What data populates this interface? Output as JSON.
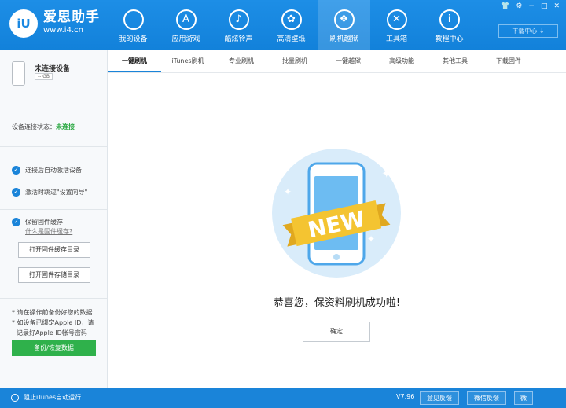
{
  "header": {
    "brand_name": "爱思助手",
    "brand_url": "www.i4.cn",
    "logo_text": "iU",
    "nav": [
      {
        "label": "我的设备",
        "icon": "apple-icon",
        "glyph": ""
      },
      {
        "label": "应用游戏",
        "icon": "app-store-icon",
        "glyph": "A"
      },
      {
        "label": "酷炫铃声",
        "icon": "bell-icon",
        "glyph": "♪"
      },
      {
        "label": "高清壁纸",
        "icon": "flower-icon",
        "glyph": "✿"
      },
      {
        "label": "刷机越狱",
        "icon": "dropbox-icon",
        "glyph": "❖"
      },
      {
        "label": "工具箱",
        "icon": "tools-icon",
        "glyph": "✕"
      },
      {
        "label": "教程中心",
        "icon": "info-icon",
        "glyph": "i"
      }
    ],
    "download_center": "下载中心 ↓",
    "window_controls": [
      "👕",
      "⚙",
      "−",
      "□",
      "✕"
    ]
  },
  "sidebar": {
    "device_name": "未连接设备",
    "device_capacity": "-- GB",
    "connection_label": "设备连接状态：",
    "connection_value": "未连接",
    "options": [
      "连接后自动激活设备",
      "激活时跳过\"设置向导\""
    ],
    "firmware_cache_label": "保留固件缓存",
    "firmware_cache_link": "什么是固件缓存?",
    "open_cache_dir": "打开固件缓存目录",
    "open_storage_dir": "打开固件存储目录",
    "notes": [
      "* 请在操作前备份好您的数据",
      "* 如设备已绑定Apple ID，请",
      "记录好Apple ID帐号密码"
    ],
    "backup_button": "备份/恢复数据"
  },
  "tabs": [
    "一键刷机",
    "iTunes刷机",
    "专业刷机",
    "批量刷机",
    "一键越狱",
    "高级功能",
    "其他工具",
    "下载固件"
  ],
  "main": {
    "badge_text": "NEW",
    "message": "恭喜您，保资料刷机成功啦!",
    "confirm_button": "确定"
  },
  "status_bar": {
    "block_itunes": "阻止iTunes自动运行",
    "version": "V7.96",
    "feedback": "意见反馈",
    "wechat": "微信反馈",
    "third": "微"
  },
  "colors": {
    "header_blue": "#1281da",
    "accent_green": "#2fb14b",
    "status_green": "#25a63d",
    "ribbon_yellow": "#f4c431"
  }
}
